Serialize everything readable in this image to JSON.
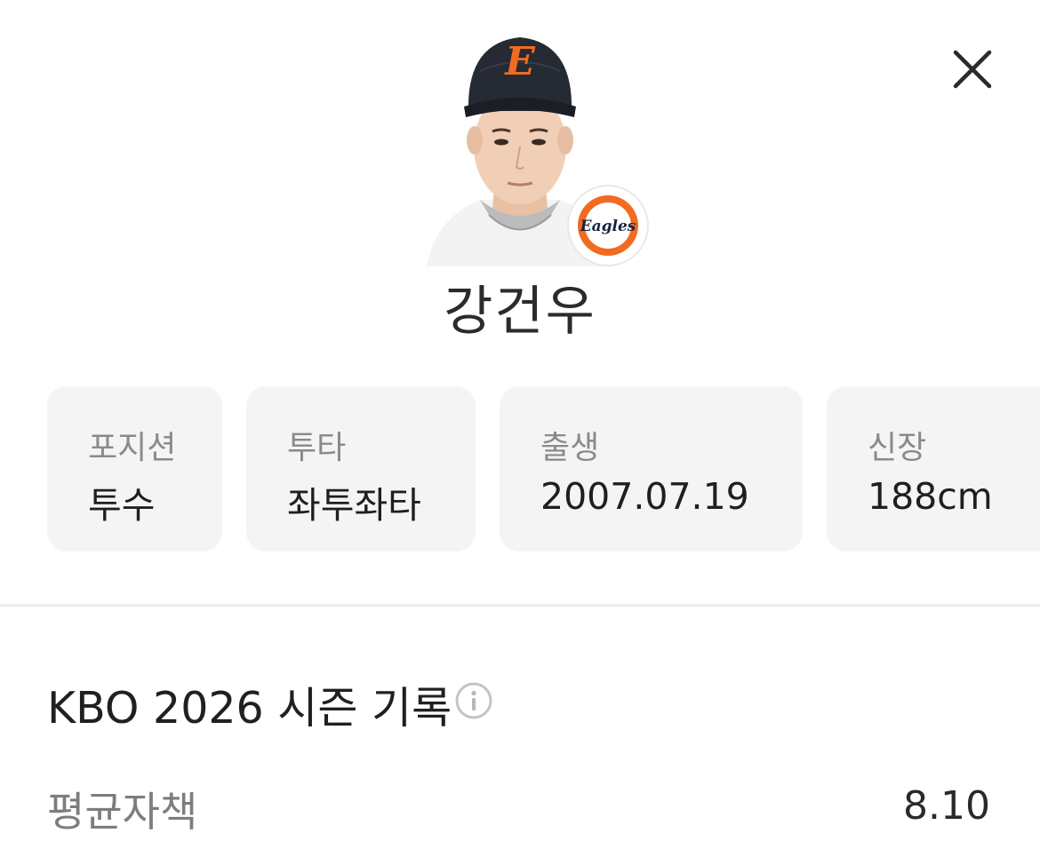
{
  "player": {
    "name": "강건우",
    "photo_icon": "player-headshot",
    "team_logo_icon": "eagles-logo",
    "team_logo_text": "Eagles",
    "cap_letter": "E"
  },
  "header": {
    "close_icon": "close-icon"
  },
  "profile": {
    "position": {
      "label": "포지션",
      "value": "투수"
    },
    "batting": {
      "label": "투타",
      "value": "좌투좌타"
    },
    "birth": {
      "label": "출생",
      "value": "2007.07.19"
    },
    "height": {
      "label": "신장",
      "value": "188cm"
    }
  },
  "season": {
    "title": "KBO 2026 시즌 기록",
    "info_icon": "info-icon",
    "stats": [
      {
        "label": "평균자책",
        "value": "8.10"
      }
    ]
  },
  "colors": {
    "card_bg": "#f4f4f5",
    "label_gray": "#8a8a8a",
    "team_orange": "#f26b21",
    "team_navy": "#1c2340"
  }
}
